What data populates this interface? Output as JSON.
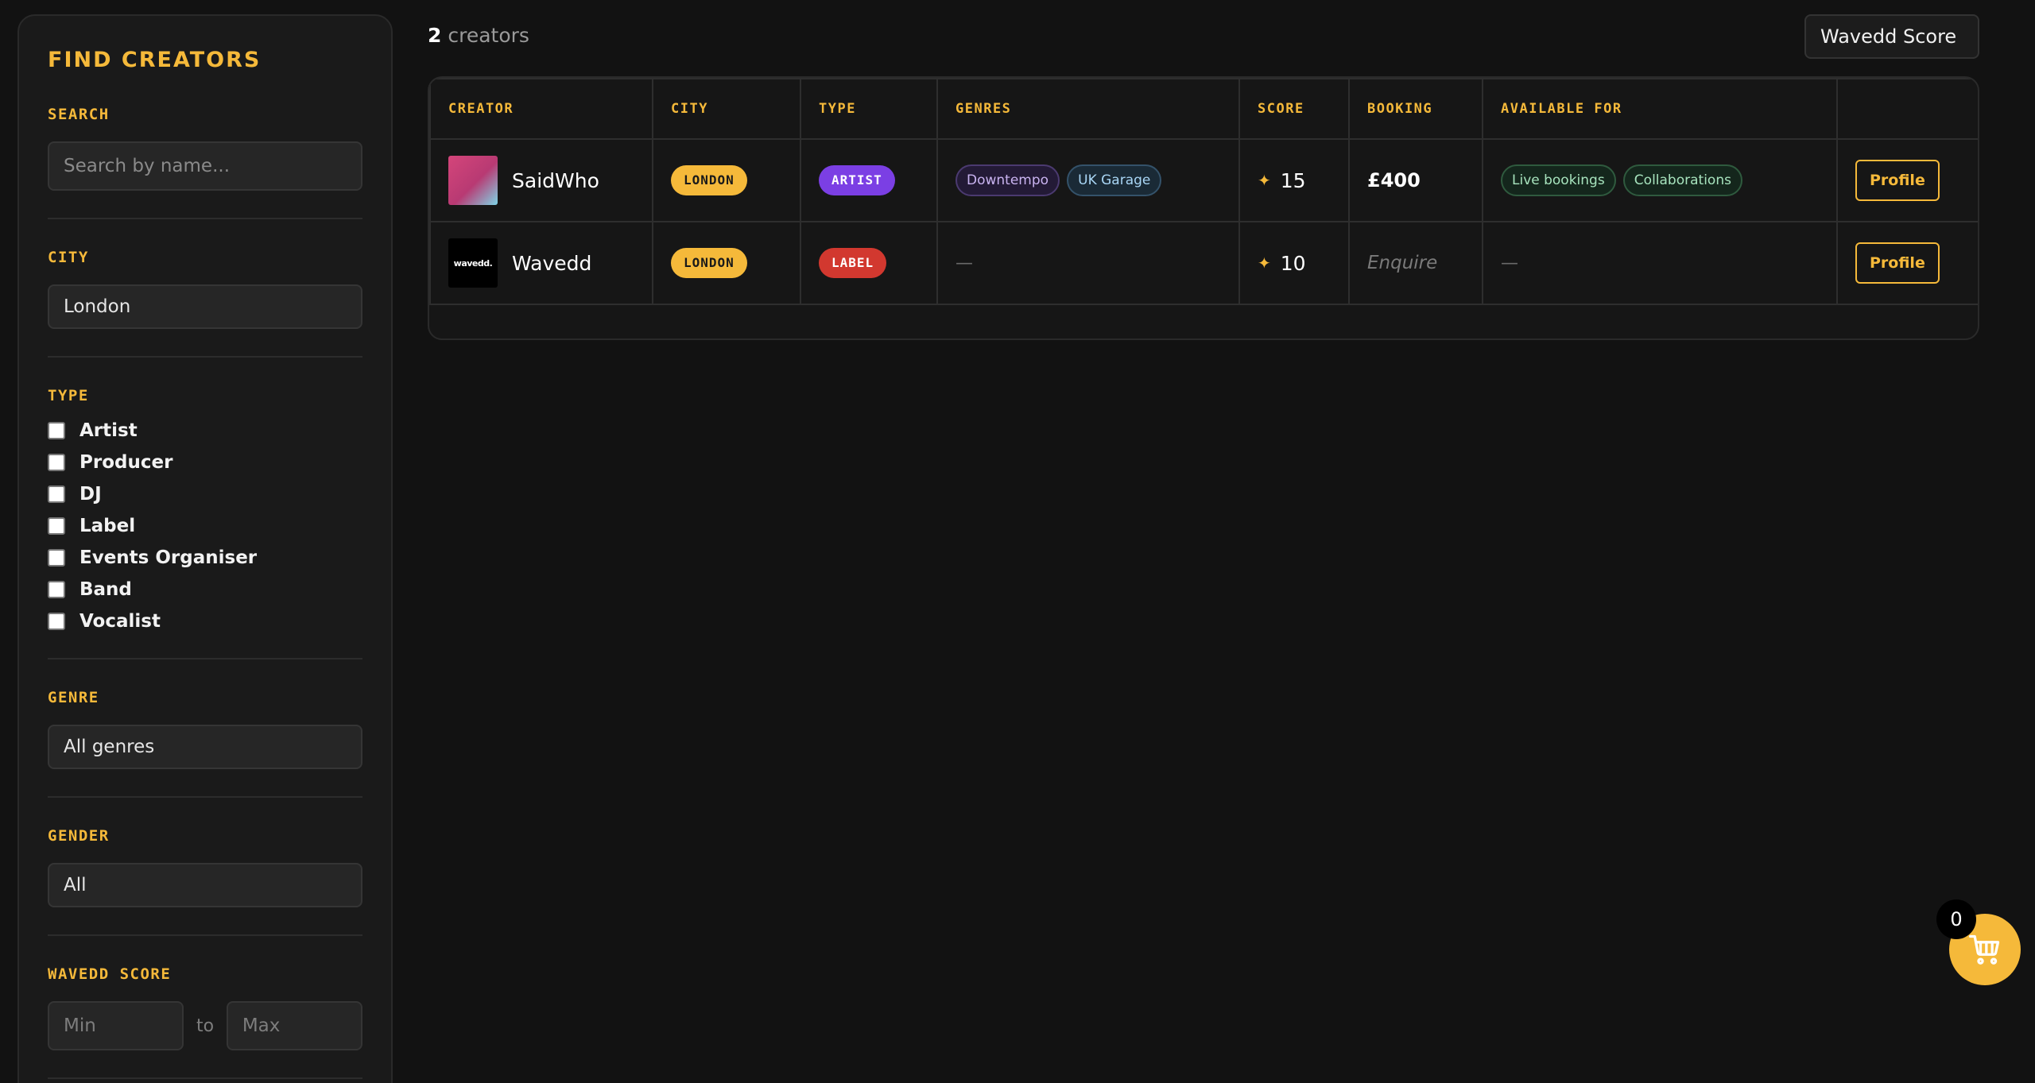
{
  "sidebar": {
    "title": "FIND CREATORS",
    "search": {
      "label": "SEARCH",
      "placeholder": "Search by name..."
    },
    "city": {
      "label": "CITY",
      "value": "London"
    },
    "type": {
      "label": "TYPE",
      "options": [
        "Artist",
        "Producer",
        "DJ",
        "Label",
        "Events Organiser",
        "Band",
        "Vocalist"
      ]
    },
    "genre": {
      "label": "GENRE",
      "value": "All genres"
    },
    "gender": {
      "label": "GENDER",
      "value": "All"
    },
    "score": {
      "label": "WAVEDD SCORE",
      "min_placeholder": "Min",
      "max_placeholder": "Max",
      "to": "to"
    }
  },
  "results": {
    "count": "2",
    "count_suffix": "creators"
  },
  "sort": {
    "value": "Wavedd Score"
  },
  "table": {
    "headers": [
      "CREATOR",
      "CITY",
      "TYPE",
      "GENRES",
      "SCORE",
      "BOOKING",
      "AVAILABLE FOR",
      ""
    ],
    "rows": [
      {
        "name": "SaidWho",
        "city": "LONDON",
        "type": "ARTIST",
        "genres": [
          "Downtempo",
          "UK Garage"
        ],
        "score": "15",
        "booking": "£400",
        "available": [
          "Live bookings",
          "Collaborations"
        ],
        "action": "Profile"
      },
      {
        "name": "Wavedd",
        "thumb_text": "wavedd.",
        "city": "LONDON",
        "type": "LABEL",
        "genres_empty": "—",
        "score": "10",
        "booking": "Enquire",
        "available_empty": "—",
        "action": "Profile"
      }
    ]
  },
  "cart": {
    "count": "0"
  },
  "colors": {
    "accent": "#f5b93a",
    "artist": "#7b3fe4",
    "label": "#d2382f",
    "background": "#121212"
  }
}
